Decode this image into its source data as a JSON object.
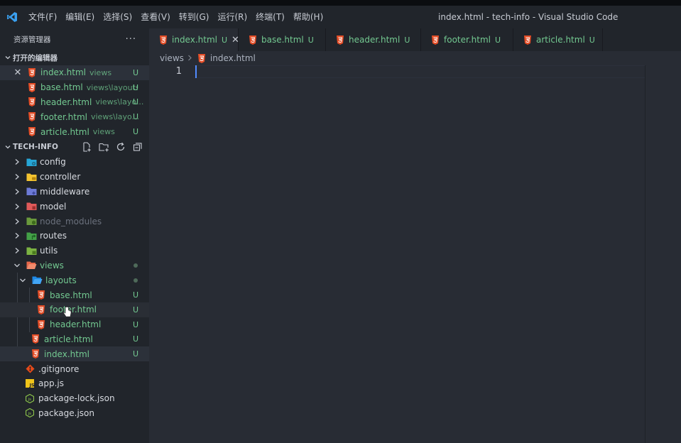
{
  "window": {
    "title": "index.html - tech-info - Visual Studio Code",
    "accent": "#0078d4"
  },
  "menu": [
    "文件(F)",
    "编辑(E)",
    "选择(S)",
    "查看(V)",
    "转到(G)",
    "运行(R)",
    "终端(T)",
    "帮助(H)"
  ],
  "sidebar": {
    "title": "资源管理器",
    "more": "···",
    "open_editors": {
      "title": "打开的编辑器",
      "items": [
        {
          "name": "index.html",
          "desc": "views",
          "badge": "U"
        },
        {
          "name": "base.html",
          "desc": "views\\layouts",
          "badge": "U"
        },
        {
          "name": "header.html",
          "desc": "views\\layo...",
          "badge": "U"
        },
        {
          "name": "footer.html",
          "desc": "views\\layo...",
          "badge": "U"
        },
        {
          "name": "article.html",
          "desc": "views",
          "badge": "U"
        }
      ]
    },
    "explorer": {
      "title": "TECH-INFO",
      "folders": [
        {
          "name": "config",
          "icon": "folder-config-icon"
        },
        {
          "name": "controller",
          "icon": "folder-controller-icon"
        },
        {
          "name": "middleware",
          "icon": "folder-middleware-icon"
        },
        {
          "name": "model",
          "icon": "folder-model-icon"
        },
        {
          "name": "node_modules",
          "icon": "folder-node-icon"
        },
        {
          "name": "routes",
          "icon": "folder-routes-icon"
        },
        {
          "name": "utils",
          "icon": "folder-utils-icon"
        }
      ],
      "views": {
        "name": "views"
      },
      "layouts": {
        "name": "layouts"
      },
      "layout_files": [
        {
          "name": "base.html",
          "badge": "U"
        },
        {
          "name": "footer.html",
          "badge": "U"
        },
        {
          "name": "header.html",
          "badge": "U"
        }
      ],
      "view_files": [
        {
          "name": "article.html",
          "badge": "U"
        },
        {
          "name": "index.html",
          "badge": "U"
        }
      ],
      "root_files": [
        {
          "name": ".gitignore",
          "icon": "git-icon"
        },
        {
          "name": "app.js",
          "icon": "js-icon"
        },
        {
          "name": "package-lock.json",
          "icon": "nodejs-icon"
        },
        {
          "name": "package.json",
          "icon": "nodejs-icon"
        }
      ]
    }
  },
  "tabs": [
    {
      "name": "index.html",
      "badge": "U",
      "close": "✕"
    },
    {
      "name": "base.html",
      "badge": "U"
    },
    {
      "name": "header.html",
      "badge": "U"
    },
    {
      "name": "footer.html",
      "badge": "U"
    },
    {
      "name": "article.html",
      "badge": "U"
    }
  ],
  "breadcrumb": {
    "folder": "views",
    "file": "index.html"
  },
  "editor": {
    "line_number": "1"
  },
  "colors": {
    "html_icon": "#e44d26",
    "git_untracked": "#73c991"
  }
}
